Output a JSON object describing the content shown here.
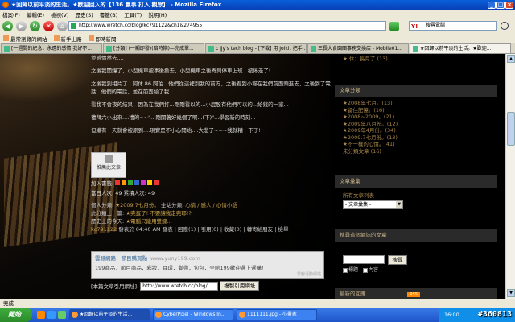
{
  "window": {
    "title": "★回歸以前平淡的生活。★歡迎回入的【136 贏事 打入 觀眾】 - Mozilla Firefox"
  },
  "menu": [
    "檔案(F)",
    "編輯(E)",
    "檢視(V)",
    "歷史(S)",
    "書籤(B)",
    "工具(T)",
    "說明(H)"
  ],
  "nav": {
    "url": "http://www.wretch.cc/blog/kc791122&ch1&274955",
    "search_text": "搜尋電腦"
  },
  "bookmarks": [
    "最常瀏覽的網站",
    "新手上路",
    "即時新聞"
  ],
  "tabs": [
    "[一週間的紀念，永遠的感情:我好不...",
    "[分類] (一觸即發)(暗時期)—完成單...",
    "c jjy's tech blog - [下載] 用 Joikit 把手...",
    "三長大食園團事務交換店 - Mobile01...",
    "★回歸以前平淡的生活。★歡迎..."
  ],
  "post": {
    "p1": "並感情然去....",
    "p2": "之後我開鐘了，小型機車被事後撕去，小型機車之後寄與停車上班...被停走了!",
    "p3": "之後我到相片了...阿休.86.阿伯...他們從這裡到我的前方，之後看到小報在我們前面頭進去，之後到了電話...他們的電話，並在前面給了我...",
    "p4": "看我不會夜的結果，因為在我們打...剛剛看以的...小屁股有他們可以的...給錢的一家...",
    "p5": "禮拜六小出來....禮的~~\"...剛開著好幾個了啊...(下)\"...學習新的時刻...",
    "p6": "但繼有一天就會被原到....現實是不小心開始....大悲了~~~我就糟一下了!!"
  },
  "share": {
    "label": "推薦此文章"
  },
  "add_row": {
    "label": "加入書籤:"
  },
  "visits": "當日人次: 49 累積人次: 49",
  "meta": {
    "line1_label": "個人分類:",
    "line1_cat": "★2009.7七月份。",
    "line1_mid": "全站分類:",
    "line1_all": "心情 / 感人 / 心情小語",
    "line2_label": "此分類上一篇:",
    "line2_link": "★完蛋了! 不要讓我走完耶!?",
    "line3": "歷史上的今天:",
    "line3_link": "★電腦只能用雙鍵...",
    "line4_author": "kc791122",
    "line4_rest": "發表於 04:40 AM 發表 | 回應(1) | 引用(0) | 收藏(0) | 轉寄給朋友 | 檢舉"
  },
  "ad": {
    "title": "雲鯨網路：節目購買點",
    "url": "www.yuny199.com",
    "desc": "199商品，節目商品，彩妝，耳環，髮帶，包包，全館199歡迎選上選購！",
    "footer": "雲鯨活動網站"
  },
  "cite": {
    "label": "[本篇文章引用網址]:",
    "value": "http://www.wretch.cc/blog/",
    "button": "複製引用網址"
  },
  "sidebar": {
    "top_item": "★ 休：長月了 (13)",
    "cat_head": "文章分類",
    "cats": [
      "★2008年七月。(13)",
      "★留住記憶。(16)",
      "★2008~2009。(21)",
      "★2009年八月份。(12)",
      "★2009年4月份。(34)",
      "★2009.7七月份。(13)",
      "★不一樣的心情。(41)",
      "未分類文章 (16)"
    ],
    "album_head": "文章彙集",
    "album_label": "所有文章列表",
    "album_select": "- 文章彙集 -",
    "search_head": "搜尋這個網誌的文章",
    "search_btn": "搜尋",
    "check_title": "標題",
    "check_content": "內容",
    "latest_head": "最新的回應",
    "rss": "RSS"
  },
  "status": "完成",
  "taskbar": {
    "start": "開始",
    "tasks": [
      "★回歸以前平淡的生活...",
      "CyberPixel - Windows In...",
      "1111111.jpg - 小畫家"
    ],
    "tray": "16:00",
    "stamp": "#360813"
  }
}
